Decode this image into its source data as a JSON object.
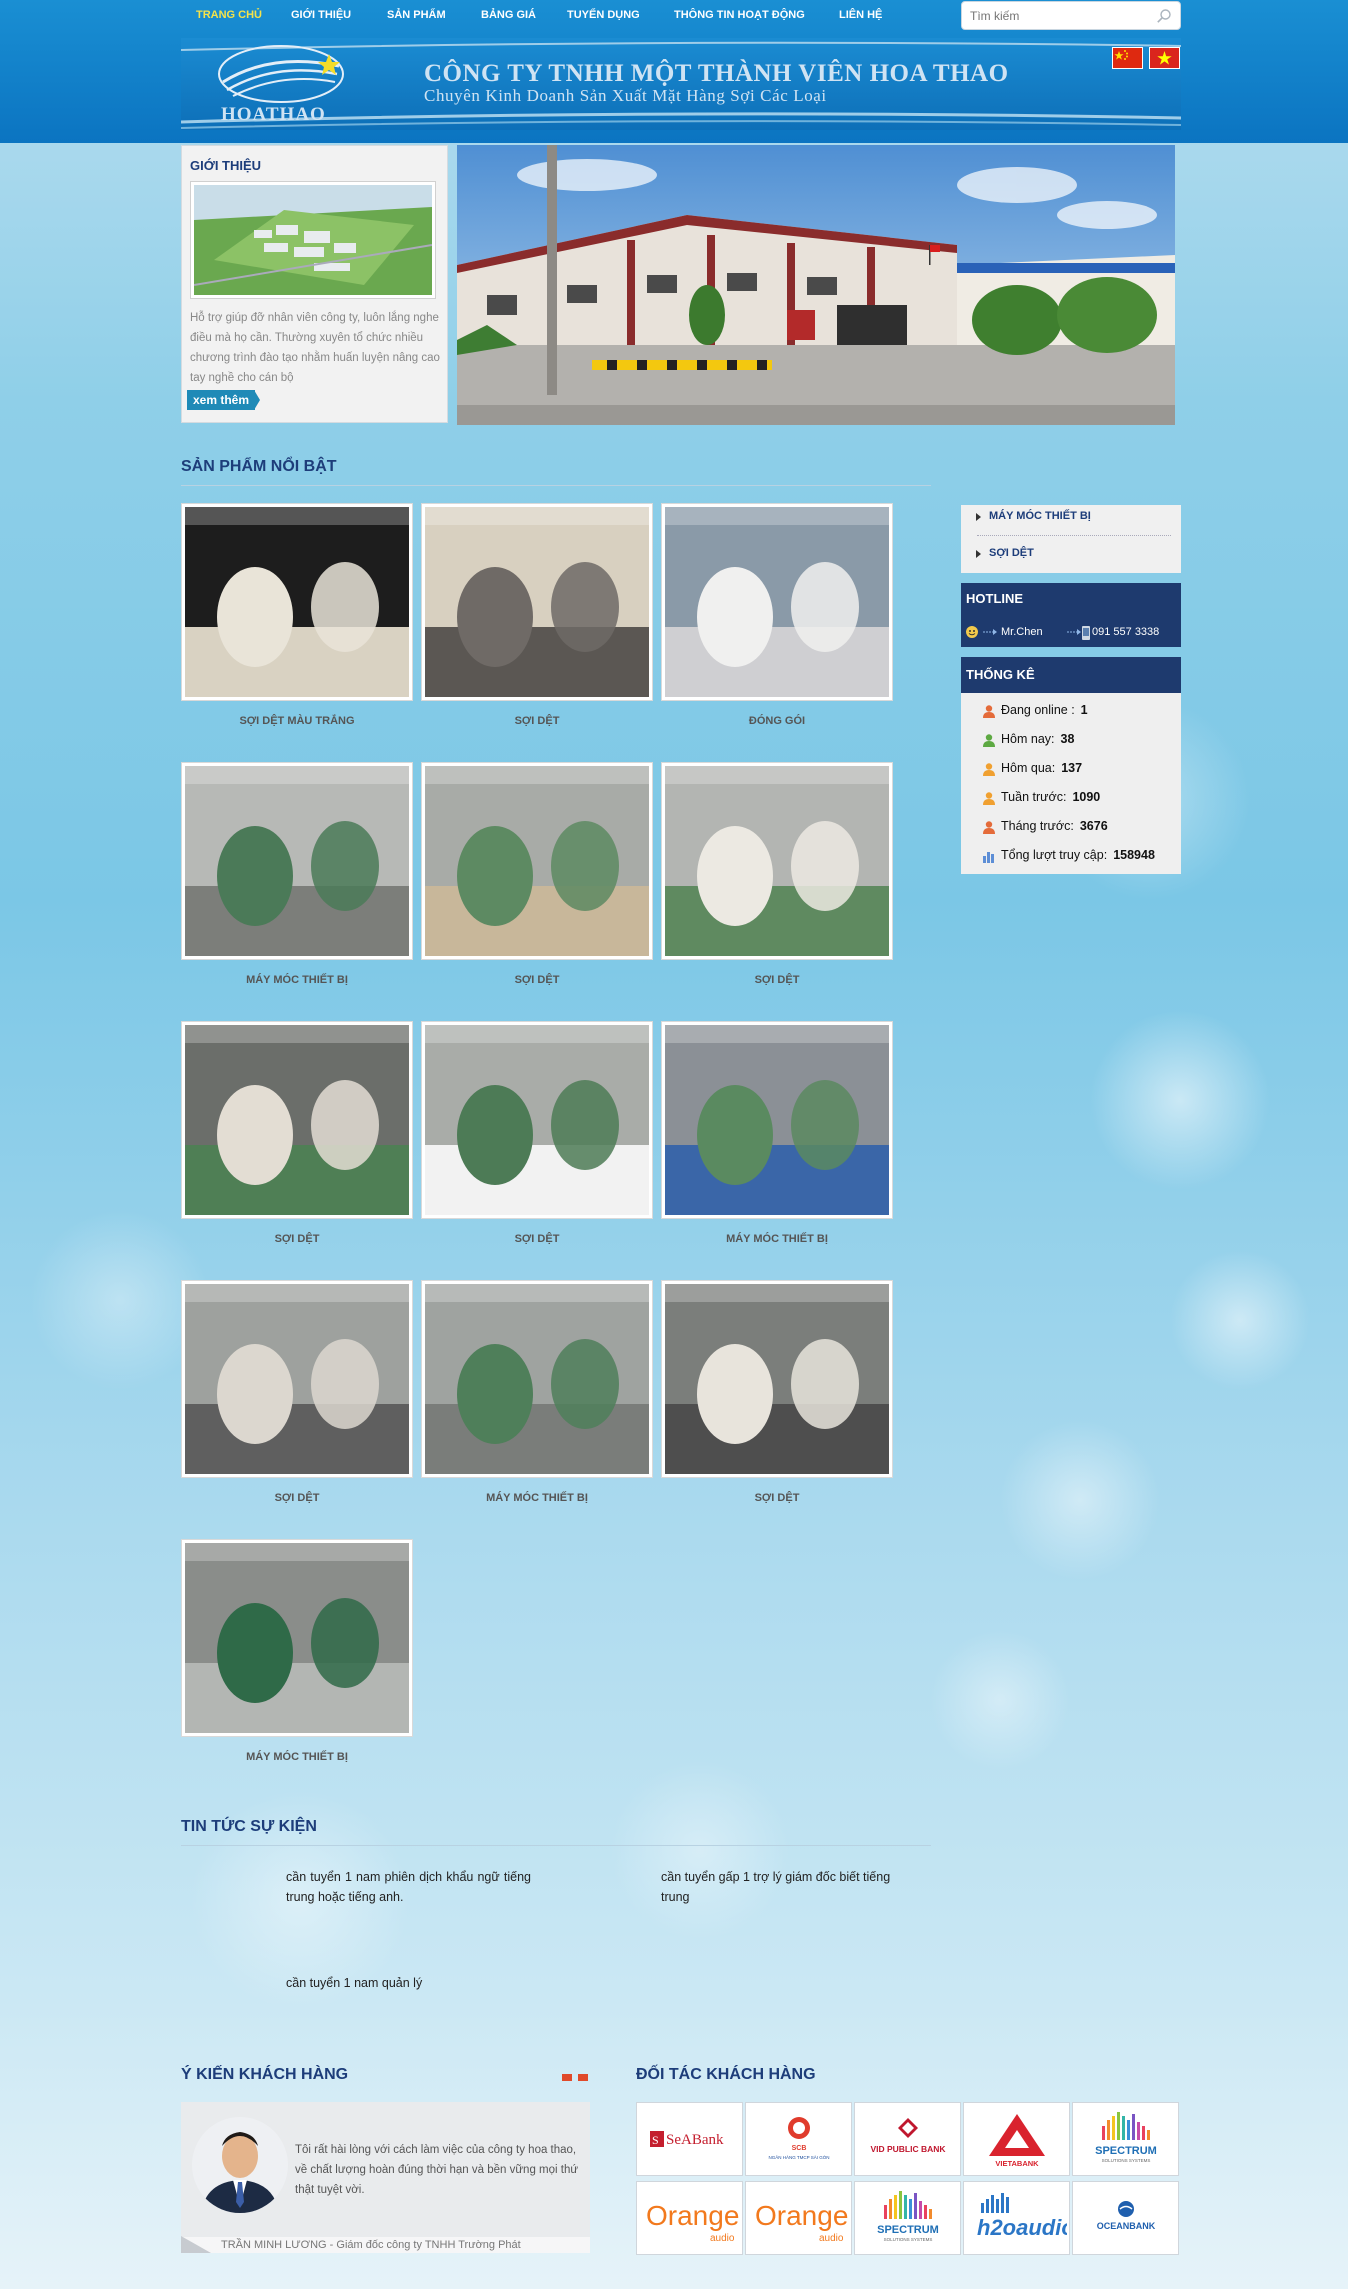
{
  "nav": {
    "items": [
      {
        "label": "TRANG CHỦ"
      },
      {
        "label": "GIỚI THIỆU"
      },
      {
        "label": "SẢN PHẨM"
      },
      {
        "label": "BẢNG GIÁ"
      },
      {
        "label": "TUYỂN DỤNG"
      },
      {
        "label": "THÔNG TIN HOẠT ĐỘNG"
      },
      {
        "label": "LIÊN HỆ"
      }
    ],
    "search_placeholder": "Tìm kiếm"
  },
  "brand": {
    "logo_text": "HOATHAO",
    "company_name": "CÔNG TY TNHH MỘT THÀNH VIÊN HOA THAO",
    "slogan": "Chuyên Kinh Doanh Sản Xuất Mặt Hàng Sợi Các Loại"
  },
  "intro": {
    "title": "GIỚI THIỆU",
    "text": "Hỗ trợ giúp đỡ nhân viên công ty, luôn lắng nghe điều mà họ cần. Thường xuyên tổ chức nhiều chương trình đào tạo nhằm huấn luyện nâng cao tay nghề cho cán bộ",
    "more_label": "xem thêm"
  },
  "products": {
    "title": "SẢN PHẨM NỔI BẬT",
    "items": [
      {
        "caption": "SỢI DỆT MÀU TRẮNG"
      },
      {
        "caption": "SỢI DỆT"
      },
      {
        "caption": "ĐÓNG GÓI"
      },
      {
        "caption": "MÁY MÓC THIẾT BỊ"
      },
      {
        "caption": "SỢI DỆT"
      },
      {
        "caption": "SỢI DỆT"
      },
      {
        "caption": "SỢI DỆT"
      },
      {
        "caption": "SỢI DỆT"
      },
      {
        "caption": "MÁY MÓC THIẾT BỊ"
      },
      {
        "caption": "SỢI DỆT"
      },
      {
        "caption": "MÁY MÓC THIẾT BỊ"
      },
      {
        "caption": "SỢI DỆT"
      },
      {
        "caption": "MÁY MÓC THIẾT BỊ"
      }
    ]
  },
  "sidebar": {
    "menu": [
      {
        "label": "MÁY MÓC THIẾT BỊ"
      },
      {
        "label": "SỢI DỆT"
      }
    ],
    "hotline": {
      "title": "HOTLINE",
      "name": "Mr.Chen",
      "phone": "091 557 3338"
    },
    "stats": {
      "title": "THỐNG KÊ",
      "rows": [
        {
          "label": "Đang online :",
          "value": "1"
        },
        {
          "label": "Hôm nay:",
          "value": "38"
        },
        {
          "label": "Hôm qua:",
          "value": "137"
        },
        {
          "label": "Tuần trước:",
          "value": "1090"
        },
        {
          "label": "Tháng trước:",
          "value": "3676"
        },
        {
          "label": "Tổng lượt truy cập:",
          "value": "158948"
        }
      ]
    }
  },
  "news": {
    "title": "TIN TỨC SỰ KIỆN",
    "items": [
      {
        "title": "cần tuyển 1 nam phiên dịch khẩu ngữ tiếng trung hoặc tiếng anh."
      },
      {
        "title": "cần tuyển gấp 1 trợ lý giám đốc biết tiếng trung"
      },
      {
        "title": "cần tuyển 1 nam quản lý"
      }
    ]
  },
  "testimonials": {
    "title": "Ý KIẾN KHÁCH HÀNG",
    "quote": "Tôi rất hài lòng với cách làm việc của công ty hoa thao, về chất lượng hoàn đúng thời hạn và bền vững mọi thứ thật tuyệt vời.",
    "author": "TRẦN MINH LƯƠNG - Giám đốc công ty TNHH Trường Phát"
  },
  "partners": {
    "title": "ĐỐI TÁC KHÁCH HÀNG",
    "logos": [
      {
        "name": "SeABank"
      },
      {
        "name": "SCB",
        "sub": "NGÂN HÀNG TMCP SÀI GÒN"
      },
      {
        "name": "VID PUBLIC BANK"
      },
      {
        "name": "VIETABANK"
      },
      {
        "name": "SPECTRUM",
        "sub": "SOLUTIONS SYSTEMS"
      },
      {
        "name": "Orange",
        "sub": "audio"
      },
      {
        "name": "Orange",
        "sub": "audio"
      },
      {
        "name": "SPECTRUM",
        "sub": "SOLUTIONS SYSTEMS"
      },
      {
        "name": "h2oaudio"
      },
      {
        "name": "OCEANBANK"
      }
    ]
  },
  "colors": {
    "header_blue": "#0b74c1",
    "nav_active": "#f5e34a",
    "section_title": "#1d3d7a",
    "side_head": "#1e3a6e"
  }
}
